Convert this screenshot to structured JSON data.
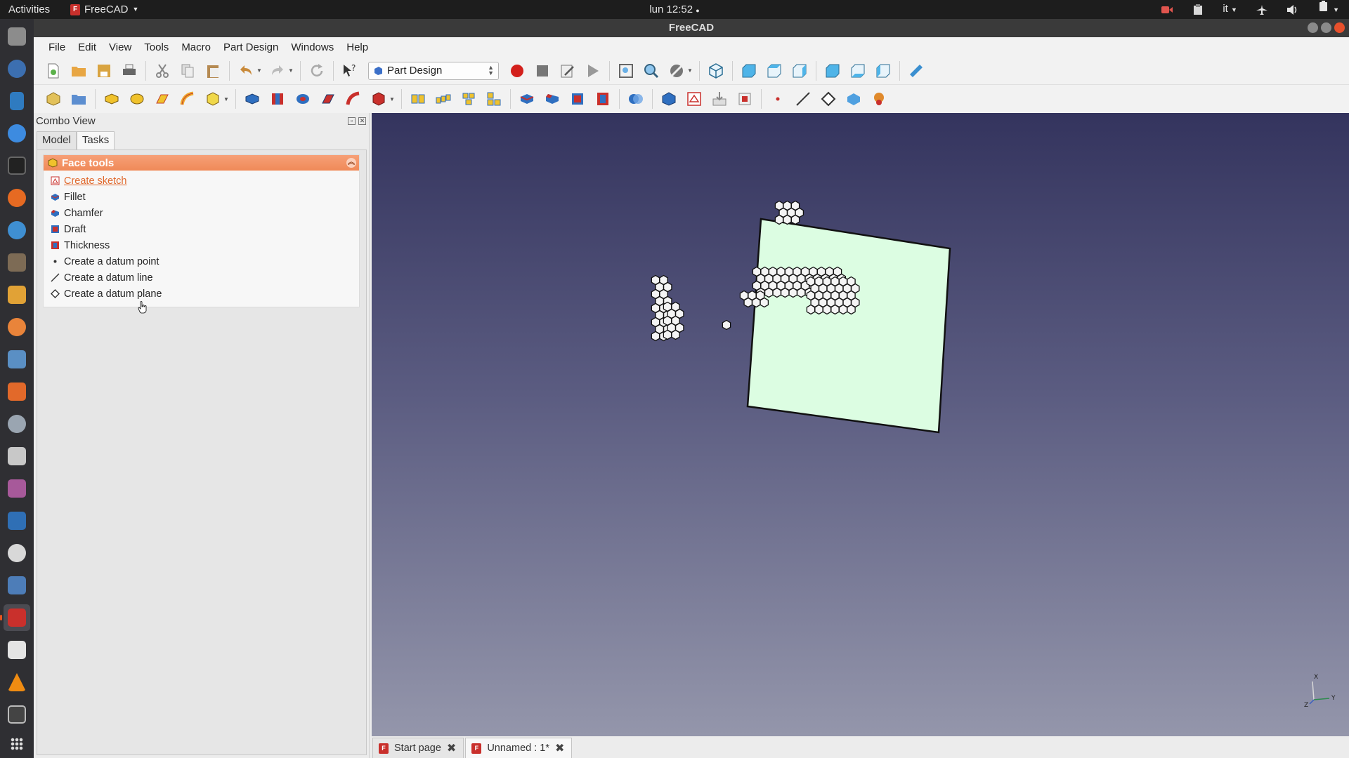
{
  "topbar": {
    "activities": "Activities",
    "app_name": "FreeCAD",
    "clock": "lun 12:52",
    "language": "it"
  },
  "window": {
    "title": "FreeCAD"
  },
  "menu": [
    "File",
    "Edit",
    "View",
    "Tools",
    "Macro",
    "Part Design",
    "Windows",
    "Help"
  ],
  "workbench": {
    "selected": "Part Design"
  },
  "combo_view": {
    "title": "Combo View",
    "tabs": [
      "Model",
      "Tasks"
    ],
    "active_tab": "Tasks",
    "panel": {
      "title": "Face tools",
      "items": [
        {
          "label": "Create sketch",
          "icon": "sketch-icon"
        },
        {
          "label": "Fillet",
          "icon": "fillet-icon"
        },
        {
          "label": "Chamfer",
          "icon": "chamfer-icon"
        },
        {
          "label": "Draft",
          "icon": "draft-icon"
        },
        {
          "label": "Thickness",
          "icon": "thickness-icon"
        },
        {
          "label": "Create a datum point",
          "icon": "datum-point-icon"
        },
        {
          "label": "Create a datum line",
          "icon": "datum-line-icon"
        },
        {
          "label": "Create a datum plane",
          "icon": "datum-plane-icon"
        }
      ]
    }
  },
  "doc_tabs": [
    {
      "label": "Start page",
      "active": false
    },
    {
      "label": "Unnamed : 1*",
      "active": true
    }
  ],
  "axis": {
    "x": "X",
    "y": "Y",
    "z": "Z"
  },
  "colors": {
    "accent": "#e95420",
    "panel_header": "#f08a58",
    "face_fill": "#dcfde2",
    "view_top": "#34345e",
    "view_bottom": "#9496ab"
  }
}
